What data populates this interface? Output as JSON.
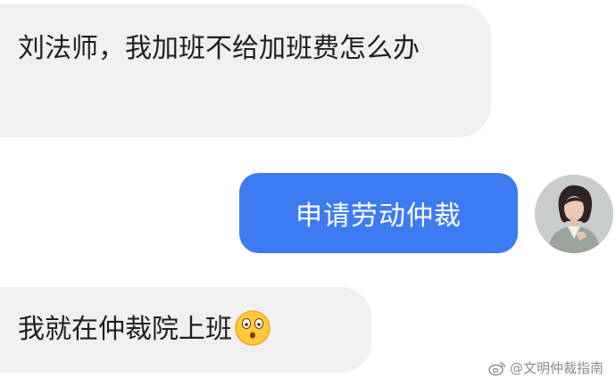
{
  "messages": [
    {
      "id": "msg1",
      "side": "incoming",
      "text": "刘法师，我加班不给加班费怎么办"
    },
    {
      "id": "msg2",
      "side": "outgoing",
      "text": "申请劳动仲裁"
    },
    {
      "id": "msg3",
      "side": "incoming",
      "text": "我就在仲裁院上班",
      "emoji": "astonished-face"
    }
  ],
  "watermark": {
    "text": "@文明仲裁指南",
    "icon": "weibo-icon"
  },
  "colors": {
    "incoming_bubble": "#f0f0f0",
    "outgoing_bubble": "#3d7bf2",
    "text_dark": "#1f1f1f",
    "text_light": "#ffffff"
  }
}
